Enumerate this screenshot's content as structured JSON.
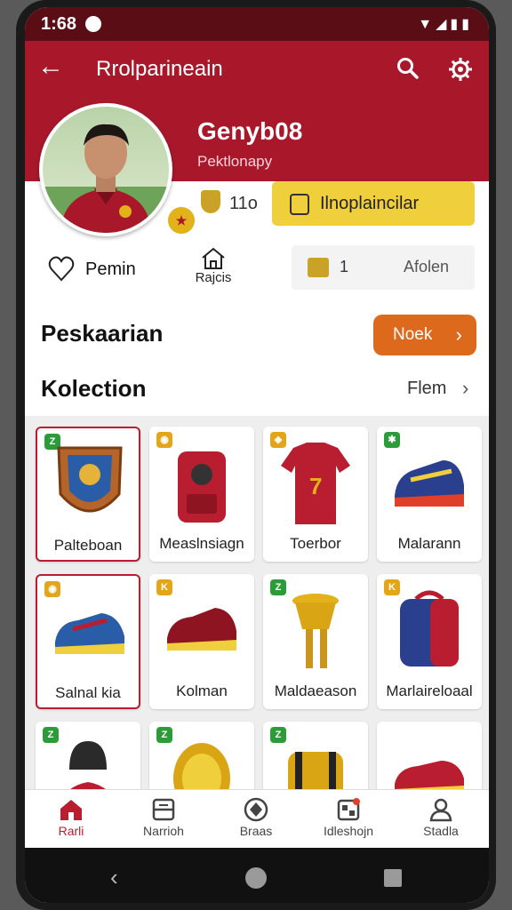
{
  "status_bar": {
    "time": "1:68",
    "icons_label": "▼◢▮▮"
  },
  "app_bar": {
    "title": "Rrolparineain",
    "back_icon": "arrow-left-icon",
    "search_icon": "search-icon",
    "settings_icon": "settings-icon"
  },
  "profile": {
    "username": "Genyb08",
    "subtitle": "Pektlonapy",
    "coin_count": "11o",
    "primary_button": "Ilnoplaincilar",
    "stat_pemin": "Pemin",
    "stat_home": "Rajcis",
    "gift_count": "1",
    "stat_box_label": "Afolen"
  },
  "sections": {
    "first_title": "Peskaarian",
    "first_button": "Noek",
    "collection_title": "Kolection",
    "see_all": "Flem"
  },
  "collection": [
    {
      "label": "Palteboan",
      "tag_color": "#2e9b3a",
      "tag": "Z"
    },
    {
      "label": "Measlnsiagn",
      "tag_color": "#e3a51a",
      "tag": "◉"
    },
    {
      "label": "Toerbor",
      "tag_color": "#e3a51a",
      "tag": "◈"
    },
    {
      "label": "Malarann",
      "tag_color": "#2e9b3a",
      "tag": "✱"
    },
    {
      "label": "Salnal kia",
      "tag_color": "#e3a51a",
      "tag": "◉"
    },
    {
      "label": "Kolman",
      "tag_color": "#e3a51a",
      "tag": "K"
    },
    {
      "label": "Maldaeason",
      "tag_color": "#2e9b3a",
      "tag": "Z"
    },
    {
      "label": "Marlaireloaal",
      "tag_color": "#e3a51a",
      "tag": "K"
    },
    {
      "label": "",
      "tag_color": "#2e9b3a",
      "tag": "Z"
    },
    {
      "label": "",
      "tag_color": "#2e9b3a",
      "tag": "Z"
    },
    {
      "label": "",
      "tag_color": "#2e9b3a",
      "tag": "Z"
    },
    {
      "label": "",
      "tag_color": "#2e9b3a",
      "tag": ""
    }
  ],
  "bottom_nav": [
    {
      "label": "Rarli",
      "icon": "home-icon"
    },
    {
      "label": "Narrioh",
      "icon": "list-icon"
    },
    {
      "label": "Braas",
      "icon": "badge-icon"
    },
    {
      "label": "Idleshojn",
      "icon": "gallery-icon"
    },
    {
      "label": "Stadla",
      "icon": "profile-icon"
    }
  ],
  "colors": {
    "primary": "#a8182a",
    "accent_orange": "#dd6a1c",
    "accent_gold": "#f0cf3c"
  }
}
